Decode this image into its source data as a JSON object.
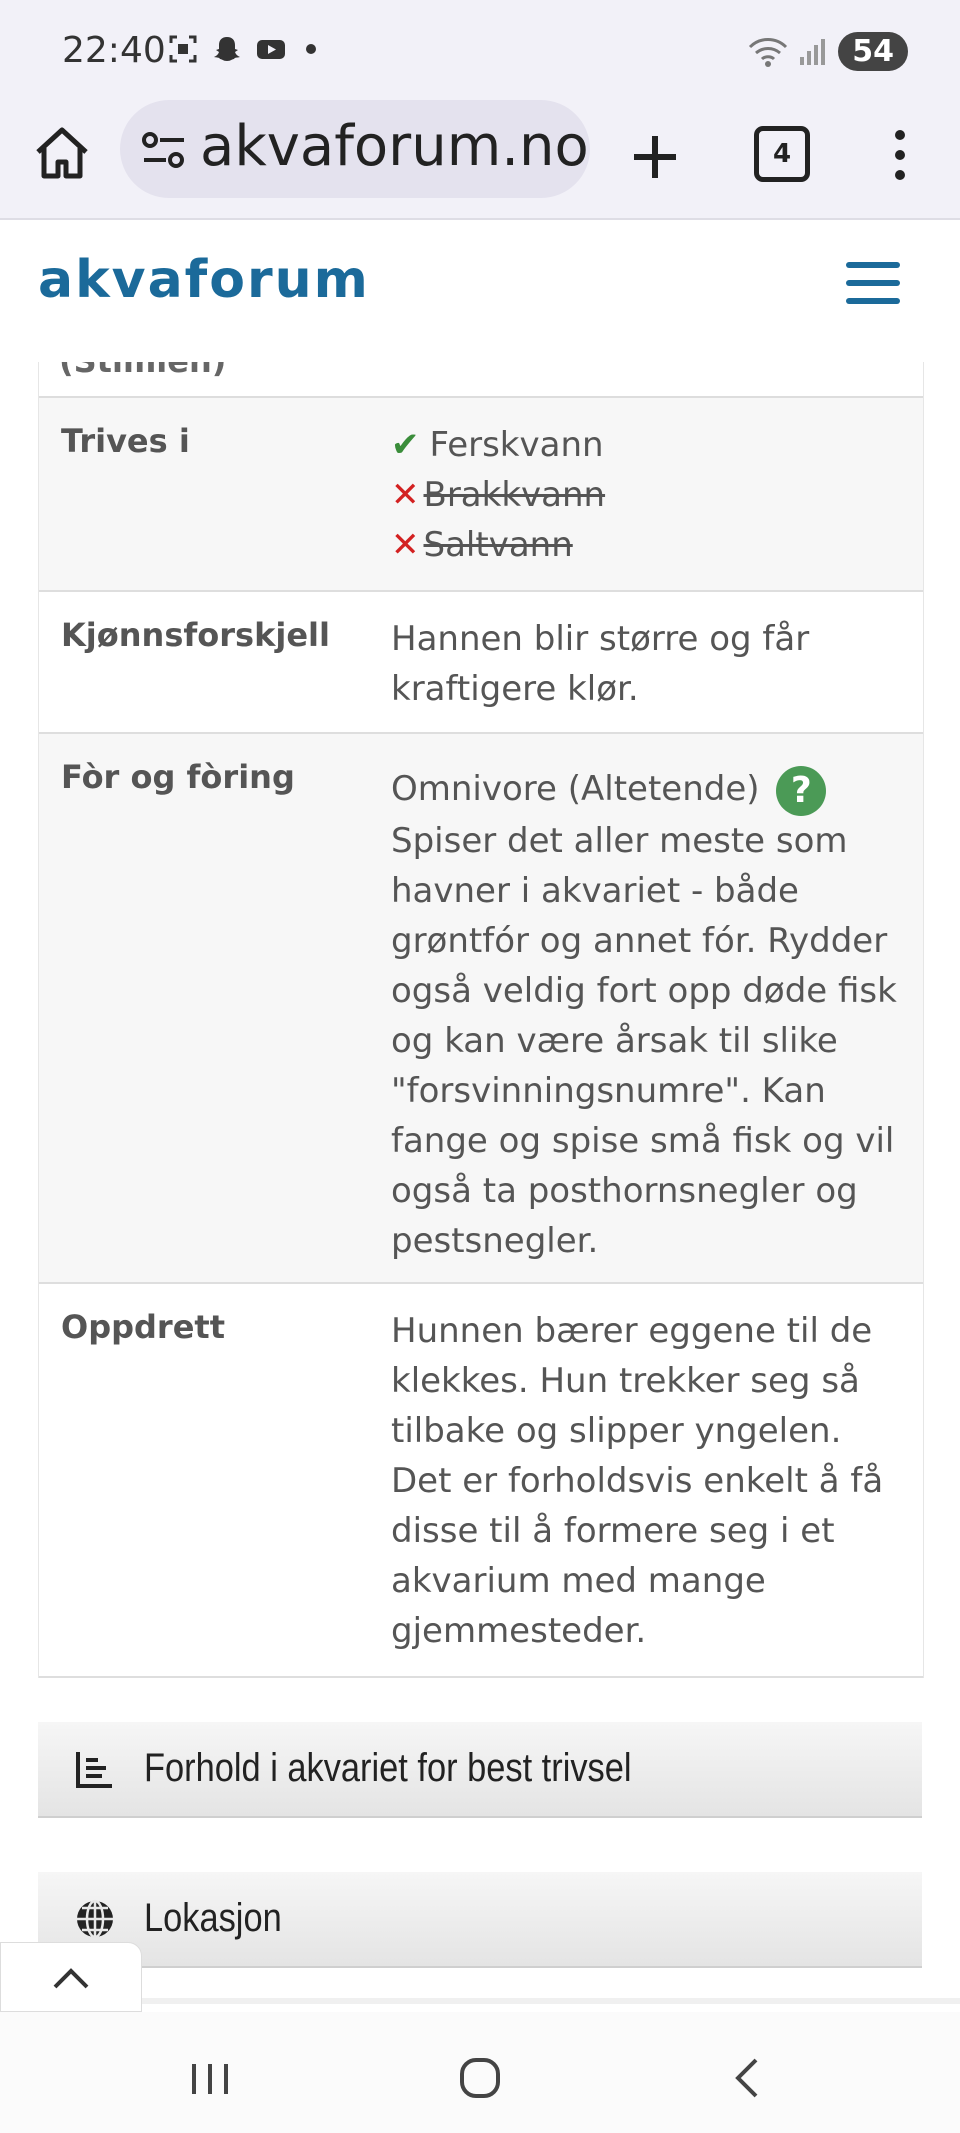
{
  "status_bar": {
    "time": "22:40",
    "icons": [
      "screenshot-icon",
      "snapchat-icon",
      "youtube-icon",
      "notification-dot"
    ],
    "right_icons": [
      "wifi-icon",
      "signal-icon"
    ],
    "battery": "54"
  },
  "browser": {
    "url": "akvaforum.no/",
    "tab_count": "4"
  },
  "site": {
    "logo": "akvaforum"
  },
  "table": {
    "partial_label": "(Stimlen)",
    "rows": [
      {
        "label": "Trives i",
        "environments": [
          {
            "name": "Ferskvann",
            "ok": true
          },
          {
            "name": "Brakkvann",
            "ok": false
          },
          {
            "name": "Saltvann",
            "ok": false
          }
        ]
      },
      {
        "label": "Kjønnsforskjell",
        "value": "Hannen blir større og får kraftigere klør."
      },
      {
        "label": "Fòr og fòring",
        "diet_type": "Omnivore (Altetende)",
        "help": "?",
        "value": "Spiser det aller meste som havner i akvariet - både grøntfór og annet fór. Rydder også veldig fort opp døde fisk og kan være årsak til slike \"forsvinningsnumre\". Kan fange og spise små fisk og vil også ta posthornsnegler og pestsnegler."
      },
      {
        "label": "Oppdrett",
        "value": "Hunnen bærer eggene til de klekkes. Hun trekker seg så tilbake og slipper yngelen. Det er forholdsvis enkelt å få disse til å formere seg i et akvarium med mange gjemmesteder."
      }
    ]
  },
  "sections": [
    {
      "label": "Forhold i akvariet for best trivsel",
      "icon": "bar-chart-icon"
    },
    {
      "label": "Lokasjon",
      "icon": "globe-icon"
    }
  ],
  "colors": {
    "brand": "#1b6a9a",
    "check": "#3a8d3a",
    "cross": "#d32121",
    "help": "#4b9a56"
  }
}
